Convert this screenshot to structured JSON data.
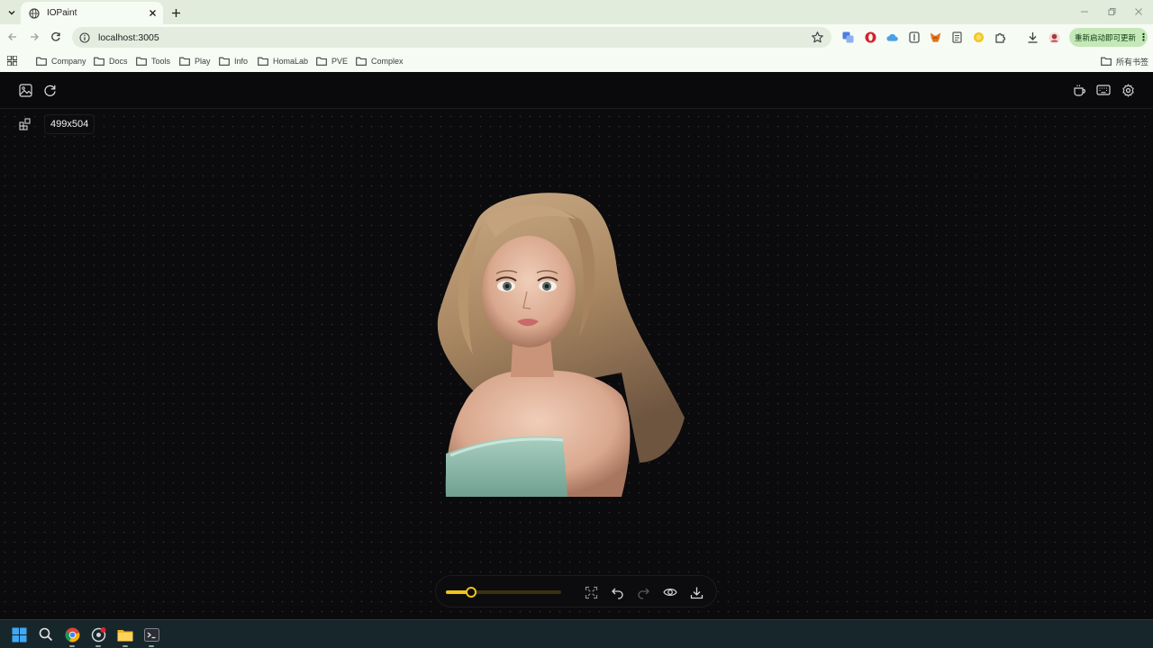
{
  "browser": {
    "tab_title": "IOPaint",
    "url": "localhost:3005",
    "update_label": "重新启动即可更新",
    "update_menu": "⋮",
    "bookmarks": [
      "Company",
      "Docs",
      "Tools",
      "Play",
      "Info",
      "HomaLab",
      "PVE",
      "Complex"
    ],
    "all_bookmarks": "所有书签"
  },
  "app": {
    "image_size": "499x504",
    "brush_size_fraction": 0.22,
    "colors": {
      "accent": "#f0c419",
      "background": "#0b0b0d"
    }
  },
  "icons": {
    "header_left": [
      "image-upload-icon",
      "refresh-icon"
    ],
    "header_right": [
      "coffee-icon",
      "keyboard-icon",
      "gear-icon"
    ],
    "controls": [
      "fit-screen-icon",
      "undo-icon",
      "redo-icon",
      "eye-icon",
      "download-icon"
    ],
    "taskbar": [
      "windows-start-icon",
      "search-icon",
      "chrome-icon",
      "app-icon",
      "file-explorer-icon",
      "terminal-icon"
    ]
  }
}
